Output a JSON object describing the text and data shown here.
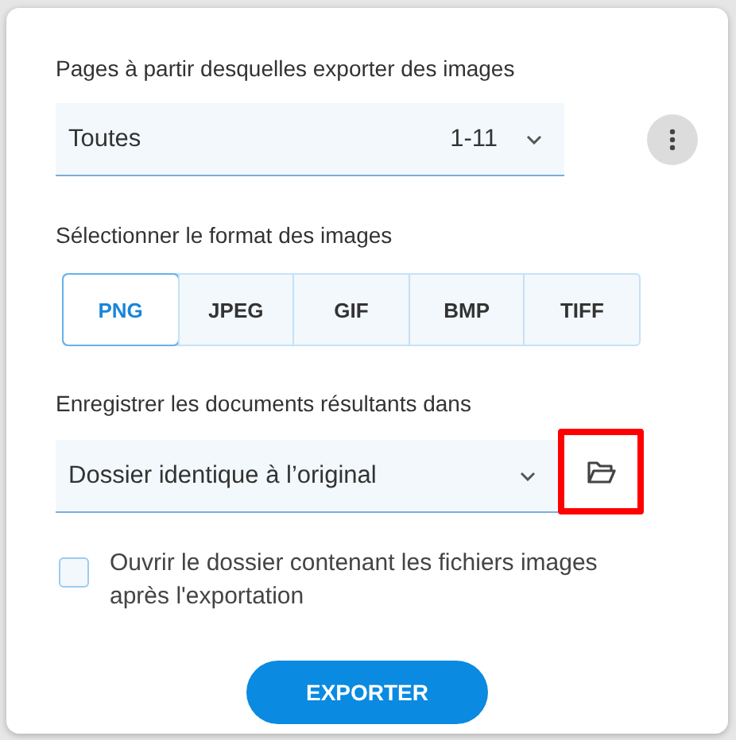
{
  "pages_section": {
    "label": "Pages à partir desquelles exporter des images",
    "value": "Toutes",
    "range": "1-11"
  },
  "format_section": {
    "label": "Sélectionner le format des images",
    "formats": [
      {
        "label": "PNG",
        "selected": true
      },
      {
        "label": "JPEG",
        "selected": false
      },
      {
        "label": "GIF",
        "selected": false
      },
      {
        "label": "BMP",
        "selected": false
      },
      {
        "label": "TIFF",
        "selected": false
      }
    ]
  },
  "destination_section": {
    "label": "Enregistrer les documents résultants dans",
    "value": "Dossier identique à l’original",
    "folder_button_highlighted": true
  },
  "open_folder": {
    "label": "Ouvrir le dossier contenant les fichiers images après l'exportation",
    "checked": false
  },
  "export_button": "EXPORTER"
}
